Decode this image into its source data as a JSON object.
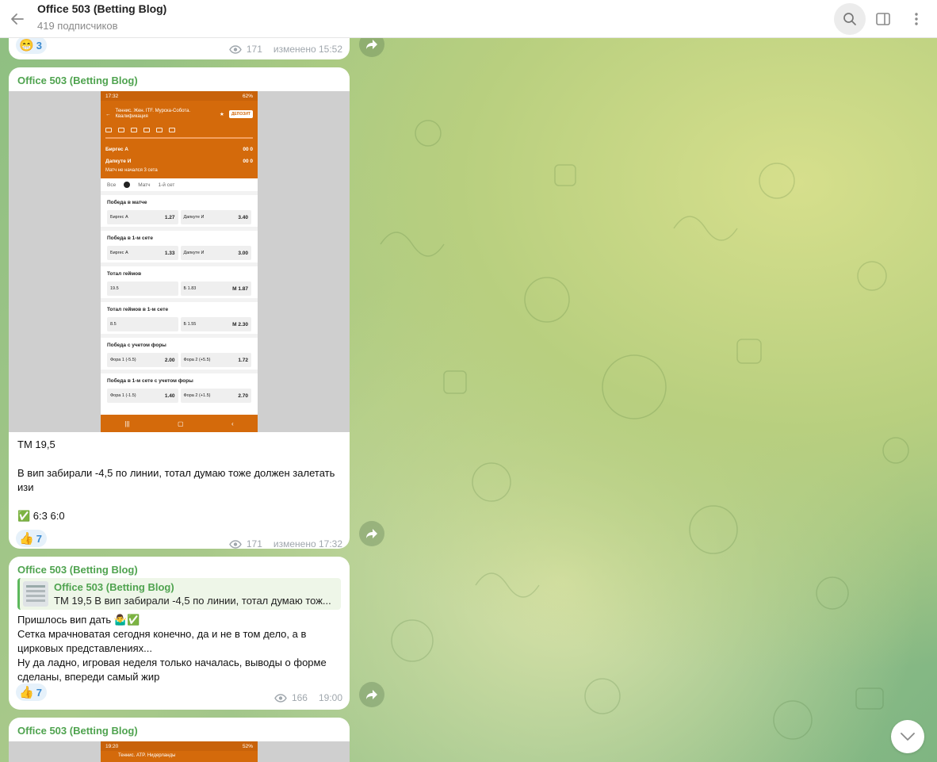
{
  "header": {
    "title": "Office 503 (Betting Blog)",
    "subtitle": "419 подписчиков",
    "icons": [
      "back-arrow-icon",
      "search-icon",
      "sidebar-toggle-icon",
      "more-vertical-icon"
    ]
  },
  "colors": {
    "accent_green": "#4fa34f",
    "reaction_blue": "#3a8ad0",
    "bet_orange": "#d46a0b"
  },
  "messages": [
    {
      "reaction": {
        "emoji": "😁",
        "count": "3"
      },
      "views": "171",
      "time": "изменено 15:52"
    },
    {
      "author": "Office 503 (Betting Blog)",
      "text": "ТМ 19,5\n\nВ вип забирали -4,5 по линии, тотал думаю тоже должен залетать изи\n\n✅ 6:3 6:0",
      "reaction": {
        "emoji": "👍",
        "count": "7"
      },
      "views": "171",
      "time": "изменено 17:32",
      "screenshot": {
        "status_time": "17:32",
        "status_right": "62%",
        "title": "Теннис. Жен. ITF. Мурска-Собота. Квалификация",
        "deposit": "ДЕПОЗИТ",
        "player1": "Биргес А",
        "player1_score": "00  0",
        "player2": "Дапкуте И",
        "player2_score": "00  0",
        "match_status": "Матч не начался  3 сета",
        "tabs": [
          "Все",
          "Матч",
          "1-й сет"
        ],
        "sections": [
          {
            "title": "Победа в матче",
            "left": "Биргес А",
            "left_val": "1.27",
            "right": "Дапкуте И",
            "right_val": "3.40"
          },
          {
            "title": "Победа в 1-м сете",
            "left": "Биргес А",
            "left_val": "1.33",
            "right": "Дапкуте И",
            "right_val": "3.00"
          },
          {
            "title": "Тотал геймов",
            "left": "19.5",
            "left_val": "",
            "right": "Б  1.83",
            "right_val": "М  1.87"
          },
          {
            "title": "Тотал геймов в 1-м сете",
            "left": "8.5",
            "left_val": "",
            "right": "Б  1.55",
            "right_val": "М  2.30"
          },
          {
            "title": "Победа с учетом форы",
            "left": "Фора 1 (-5.5)",
            "left_val": "2.00",
            "right": "Фора 2 (+5.5)",
            "right_val": "1.72"
          },
          {
            "title": "Победа в 1-м сете с учетом форы",
            "left": "Фора 1 (-1.5)",
            "left_val": "1.40",
            "right": "Фора 2 (+1.5)",
            "right_val": "2.70"
          }
        ]
      }
    },
    {
      "author": "Office 503 (Betting Blog)",
      "reply_author": "Office 503 (Betting Blog)",
      "reply_text": "ТМ 19,5  В вип забирали -4,5 по линии, тотал думаю тож...",
      "text": "Пришлось вип дать 🤷‍♂️✅\nСетка мрачноватая сегодня конечно, да и не в том дело, а в цирковых представлениях...\nНу да ладно, игровая неделя только началась, выводы о форме сделаны, впереди самый жир",
      "reaction": {
        "emoji": "👍",
        "count": "7"
      },
      "views": "166",
      "time": "19:00"
    },
    {
      "author": "Office 503 (Betting Blog)",
      "screenshot": {
        "status_time": "19:20",
        "status_right": "52%",
        "title": "Теннис. ATP. Нидерланды"
      }
    }
  ]
}
